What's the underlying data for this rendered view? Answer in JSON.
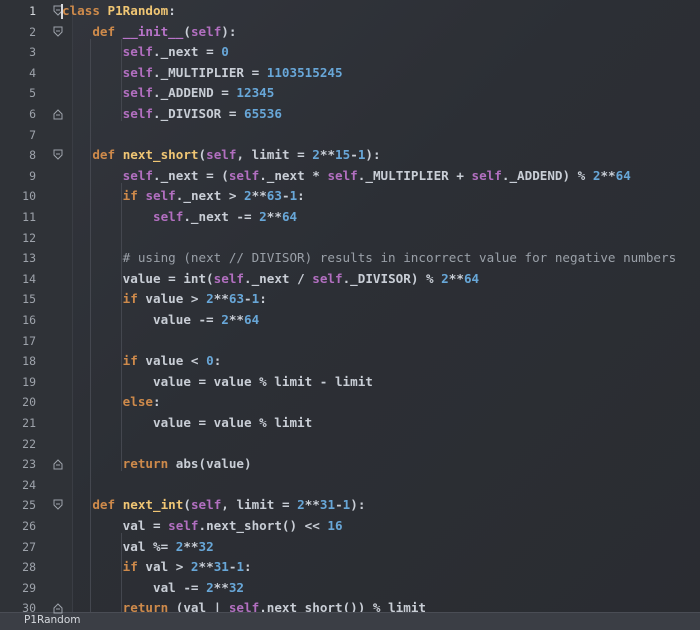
{
  "gutter": {
    "line_numbers": [
      "1",
      "2",
      "3",
      "4",
      "5",
      "6",
      "7",
      "8",
      "9",
      "10",
      "11",
      "12",
      "13",
      "14",
      "15",
      "16",
      "17",
      "18",
      "19",
      "20",
      "21",
      "22",
      "23",
      "24",
      "25",
      "26",
      "27",
      "28",
      "29",
      "30"
    ]
  },
  "code": {
    "l1": "class P1Random:",
    "l2": "    def __init__(self):",
    "l3": "        self._next = 0",
    "l4": "        self._MULTIPLIER = 1103515245",
    "l5": "        self._ADDEND = 12345",
    "l6": "        self._DIVISOR = 65536",
    "l8": "    def next_short(self, limit = 2**15-1):",
    "l9": "        self._next = (self._next * self._MULTIPLIER + self._ADDEND) % 2**64",
    "l10": "        if self._next > 2**63-1:",
    "l11": "            self._next -= 2**64",
    "l13": "        # using (next // DIVISOR) results in incorrect value for negative numbers",
    "l14": "        value = int(self._next / self._DIVISOR) % 2**64",
    "l15": "        if value > 2**63-1:",
    "l16": "            value -= 2**64",
    "l18": "        if value < 0:",
    "l19": "            value = value % limit - limit",
    "l20": "        else:",
    "l21": "            value = value % limit",
    "l23": "        return abs(value)",
    "l25": "    def next_int(self, limit = 2**31-1):",
    "l26": "        val = self.next_short() << 16",
    "l27": "        val %= 2**32",
    "l28": "        if val > 2**31-1:",
    "l29": "            val -= 2**32",
    "l30": "        return (val | self.next_short()) % limit"
  },
  "statusbar": {
    "breadcrumb": "P1Random"
  },
  "colors": {
    "keyword": "#ce8a4b",
    "function": "#f0c674",
    "number": "#68a7d8",
    "self": "#b26fc0",
    "dunder": "#b874c9",
    "comment": "#9aa0a8",
    "text": "#c9ced6",
    "background": "#2b2d33"
  },
  "icons": {
    "fold_markers": "fold-marker-icon"
  }
}
